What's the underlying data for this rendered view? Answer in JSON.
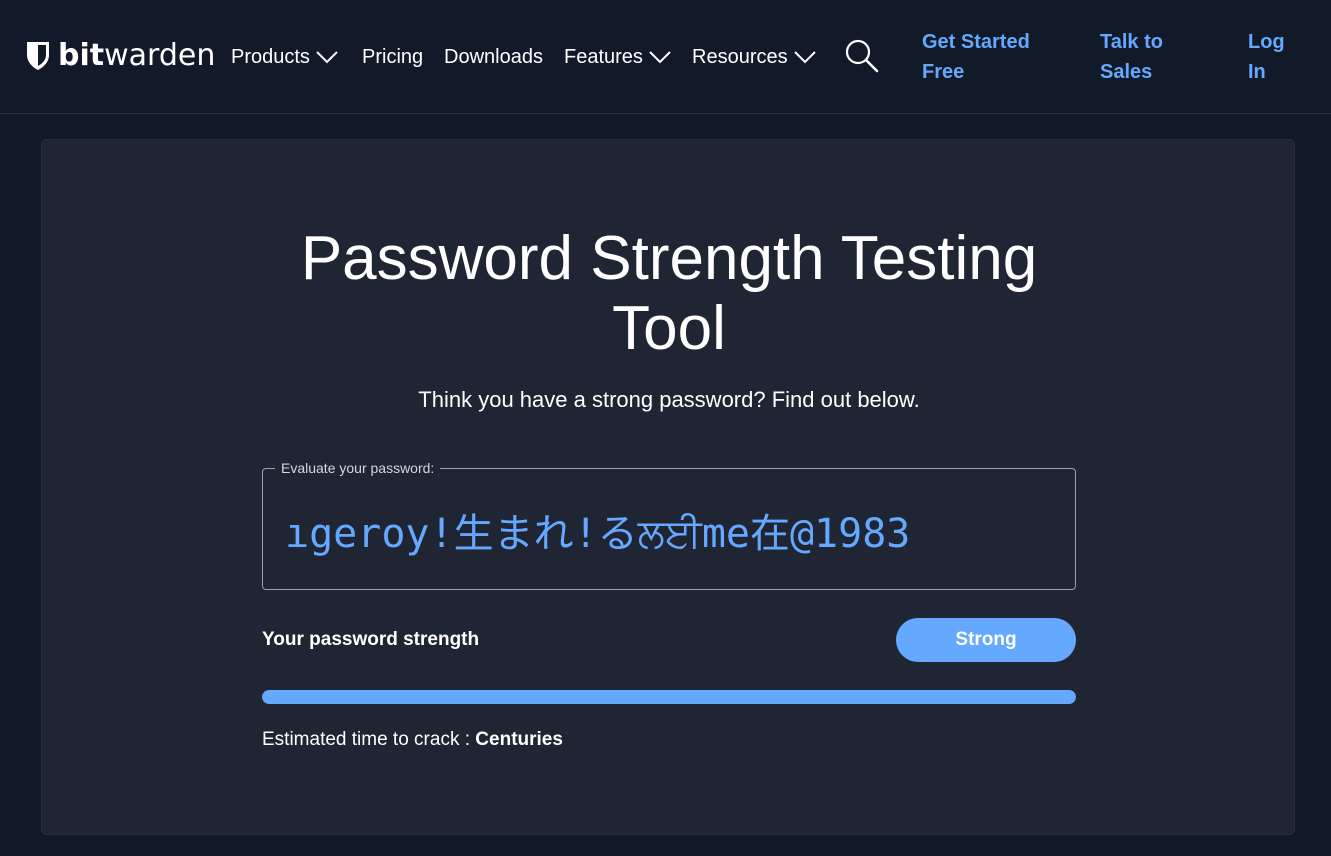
{
  "nav": {
    "logo": {
      "bold": "bit",
      "light": "warden"
    },
    "items": [
      {
        "label": "Products",
        "dropdown": true
      },
      {
        "label": "Pricing",
        "dropdown": false
      },
      {
        "label": "Downloads",
        "dropdown": false
      },
      {
        "label": "Features",
        "dropdown": true
      },
      {
        "label": "Resources",
        "dropdown": true
      }
    ],
    "cta": {
      "get_started_line1": "Get Started",
      "get_started_line2": "Free",
      "talk_line1": "Talk to",
      "talk_line2": "Sales",
      "login_line1": "Log",
      "login_line2": "In"
    }
  },
  "main": {
    "title_line1": "Password Strength Testing",
    "title_line2": "Tool",
    "subtitle": "Think you have a strong password? Find out below.",
    "field_legend": "Evaluate your password:",
    "password_value": "ıgeroy!生まれ!るਲਈme在@1983",
    "strength_label": "Your password strength",
    "strength_value": "Strong",
    "strength_fraction": 1.0,
    "crack_label": "Estimated time to crack : ",
    "crack_value": "Centuries"
  },
  "colors": {
    "accent": "#65a8ff",
    "background": "#111827",
    "card": "#1f2533"
  }
}
